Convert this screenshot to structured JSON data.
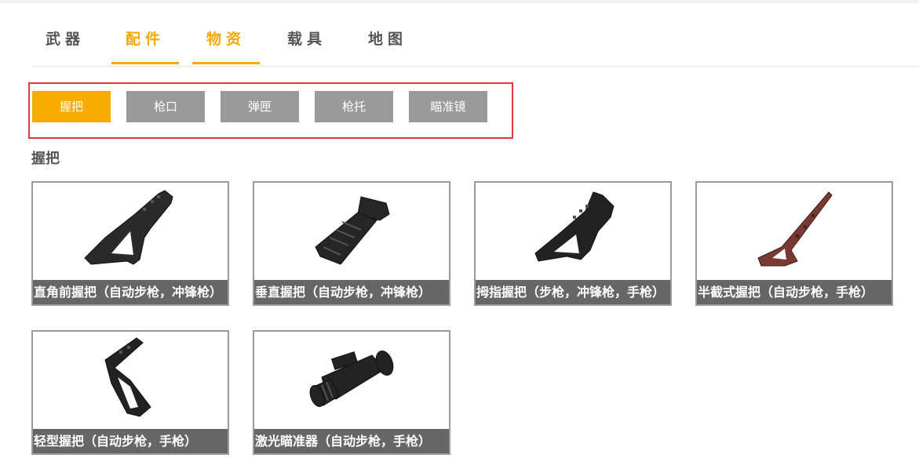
{
  "main_tabs": [
    {
      "label": "武器",
      "active": false
    },
    {
      "label": "配件",
      "active": true
    },
    {
      "label": "物资",
      "active": true
    },
    {
      "label": "载具",
      "active": false
    },
    {
      "label": "地图",
      "active": false
    }
  ],
  "sub_tabs": [
    {
      "label": "握把",
      "active": true
    },
    {
      "label": "枪口",
      "active": false
    },
    {
      "label": "弹匣",
      "active": false
    },
    {
      "label": "枪托",
      "active": false
    },
    {
      "label": "瞄准镜",
      "active": false
    }
  ],
  "section_title": "握把",
  "items": [
    {
      "caption": "直角前握把（自动步枪，冲锋枪）",
      "icon": "angled-foregrip-icon"
    },
    {
      "caption": "垂直握把（自动步枪，冲锋枪）",
      "icon": "vertical-foregrip-icon"
    },
    {
      "caption": "拇指握把（步枪，冲锋枪，手枪）",
      "icon": "thumb-grip-icon"
    },
    {
      "caption": "半截式握把（自动步枪，手枪）",
      "icon": "half-grip-icon"
    },
    {
      "caption": "轻型握把（自动步枪，手枪）",
      "icon": "light-grip-icon"
    },
    {
      "caption": "激光瞄准器（自动步枪，手枪）",
      "icon": "laser-sight-icon"
    }
  ],
  "colors": {
    "accent": "#f5a800",
    "inactive_button": "#9a9a9a",
    "caption_bar": "#666666",
    "highlight_box": "#e03a3a"
  }
}
